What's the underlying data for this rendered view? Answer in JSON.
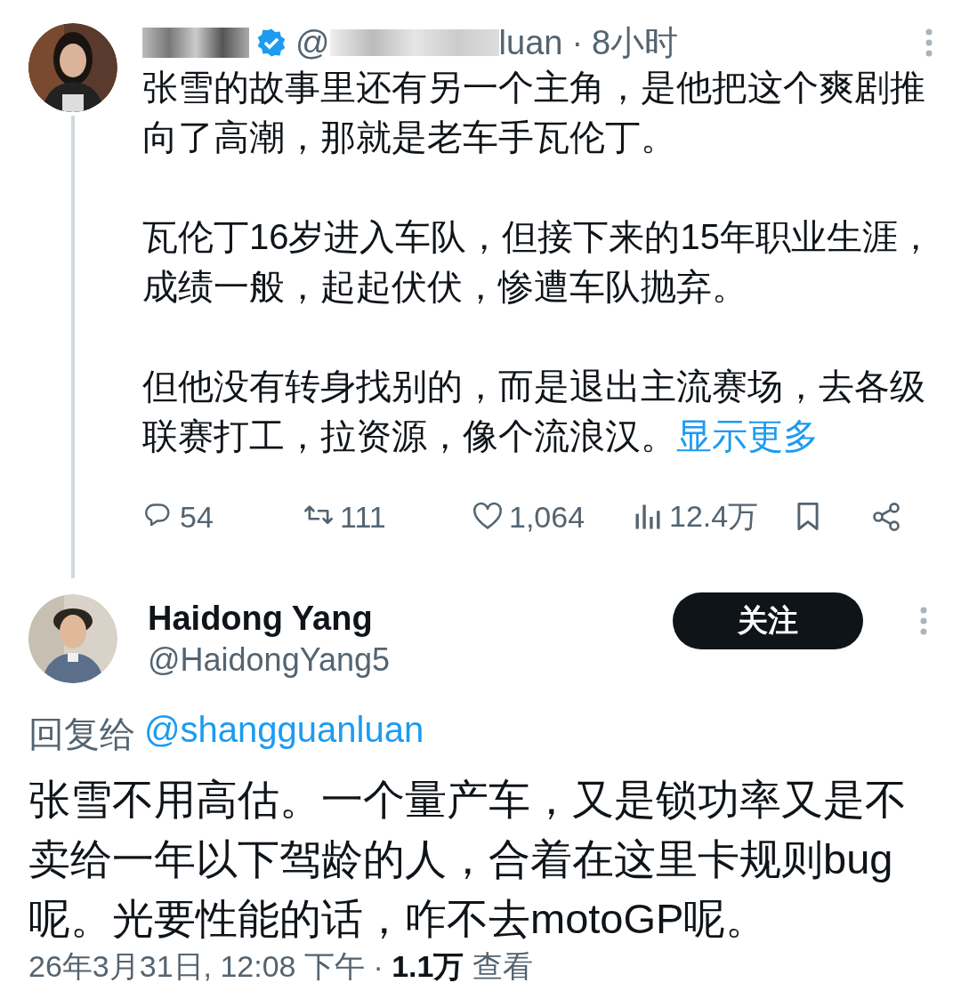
{
  "post": {
    "author": {
      "handle_start": "@",
      "handle_end": "luan",
      "verified": true
    },
    "separator": "·",
    "time": "8小时",
    "paragraphs": [
      "张雪的故事里还有另一个主角，是他把这个爽剧推向了高潮，那就是老车手瓦伦丁。",
      "瓦伦丁16岁进入车队，但接下来的15年职业生涯，成绩一般，起起伏伏，惨遭车队抛弃。",
      "但他没有转身找别的，而是退出主流赛场，去各级联赛打工，拉资源，像个流浪汉。"
    ],
    "show_more": "显示更多",
    "actions": [
      {
        "kind": "reply",
        "count": "54"
      },
      {
        "kind": "repost",
        "count": "111"
      },
      {
        "kind": "like",
        "count": "1,064"
      },
      {
        "kind": "views",
        "count": "12.4万"
      },
      {
        "kind": "bookmark"
      },
      {
        "kind": "share"
      }
    ]
  },
  "reply": {
    "author": {
      "name": "Haidong Yang",
      "handle": "@HaidongYang5"
    },
    "follow_button": "关注",
    "replying_to_label": "回复给",
    "replying_to_handle": "@shangguanluan",
    "text": "张雪不用高估。一个量产车，又是锁功率又是不卖给一年以下驾龄的人，合着在这里卡规则bug呢。光要性能的话，咋不去motoGP呢。",
    "timestamp": "26年3月31日, 12:08 下午 · **1.1万** 查看"
  }
}
